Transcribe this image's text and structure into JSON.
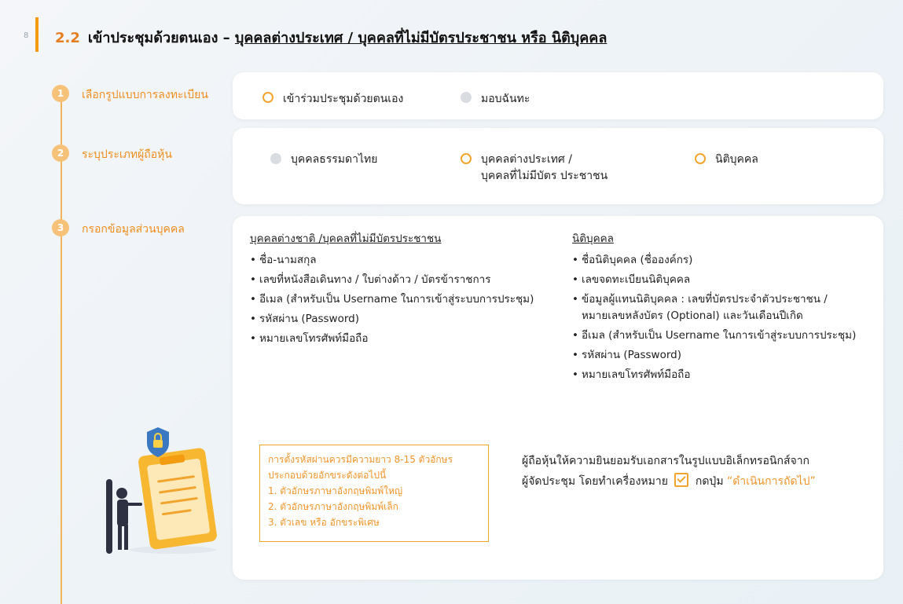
{
  "page_number": "8",
  "title": {
    "number": "2.2",
    "text": "เข้าประชุมด้วยตนเอง – ",
    "underlined": "บุคคลต่างประเทศ / บุคคลที่ไม่มีบัตรประชาชน หรือ นิติบุคคล"
  },
  "steps": [
    {
      "number": "1",
      "label": "เลือกรูปแบบการลงทะเบียน"
    },
    {
      "number": "2",
      "label": "ระบุประเภทผู้ถือหุ้น"
    },
    {
      "number": "3",
      "label": "กรอกข้อมูลส่วนบุคคล"
    }
  ],
  "step1_options": [
    {
      "label": "เข้าร่วมประชุมด้วยตนเอง",
      "selected": true
    },
    {
      "label": "มอบฉันทะ",
      "selected": false
    }
  ],
  "step2_options": [
    {
      "line1": "บุคคลธรรมดาไทย",
      "line2": "",
      "selected": false
    },
    {
      "line1": "บุคคลต่างประเทศ /",
      "line2": "บุคคลที่ไม่มีบัตร ประชาชน",
      "selected": true
    },
    {
      "line1": "นิติบุคคล",
      "line2": "",
      "selected": true
    }
  ],
  "foreign_col": {
    "heading": "บุคคลต่างชาติ /บุคคลที่ไม่มีบัตรประชาชน",
    "items": [
      "ชื่อ-นามสกุล",
      "เลขที่หนังสือเดินทาง / ใบต่างด้าว / บัตรข้าราชการ",
      "อีเมล (สำหรับเป็น Username ในการเข้าสู่ระบบการประชุม)",
      "รหัสผ่าน (Password)",
      "หมายเลขโทรศัพท์มือถือ"
    ]
  },
  "juristic_col": {
    "heading": "นิติบุคคล",
    "item1": "ชื่อนิติบุคคล (ชื่อองค์กร)",
    "item2": "เลขจดทะเบียนนิติบุคคล",
    "item3a": "ข้อมูลผู้แทนนิติบุคคล : เลขที่บัตรประจำตัวประชาชน /",
    "item3b": "หมายเลขหลังบัตร (Optional) และวันเดือนปีเกิด",
    "item4": "อีเมล (สำหรับเป็น Username ในการเข้าสู่ระบบการประชุม)",
    "item5": "รหัสผ่าน (Password)",
    "item6": "หมายเลขโทรศัพท์มือถือ"
  },
  "password_note": {
    "line1": "การตั้งรหัสผ่านควรมีความยาว 8-15 ตัวอักษร",
    "line2": "ประกอบด้วยอักขระดังต่อไปนี้",
    "rule1": "1.  ตัวอักษรภาษาอังกฤษพิมพ์ใหญ่",
    "rule2": "2.  ตัวอักษรภาษาอังกฤษพิมพ์เล็ก",
    "rule3": "3.  ตัวเลข หรือ อักขระพิเศษ"
  },
  "consent": {
    "line1": "ผู้ถือหุ้นให้ความยินยอมรับเอกสารในรูปแบบอิเล็กทรอนิกส์จาก",
    "line2_pre": "ผู้จัดประชุม โดยทำเครื่องหมาย",
    "line2_mid": "กดปุ่ม",
    "line2_highlight": "“ดำเนินการถัดไป”"
  },
  "colors": {
    "accent": "#f2a52e",
    "step_circle": "#f6c27a",
    "label_orange": "#ef8d1f"
  }
}
